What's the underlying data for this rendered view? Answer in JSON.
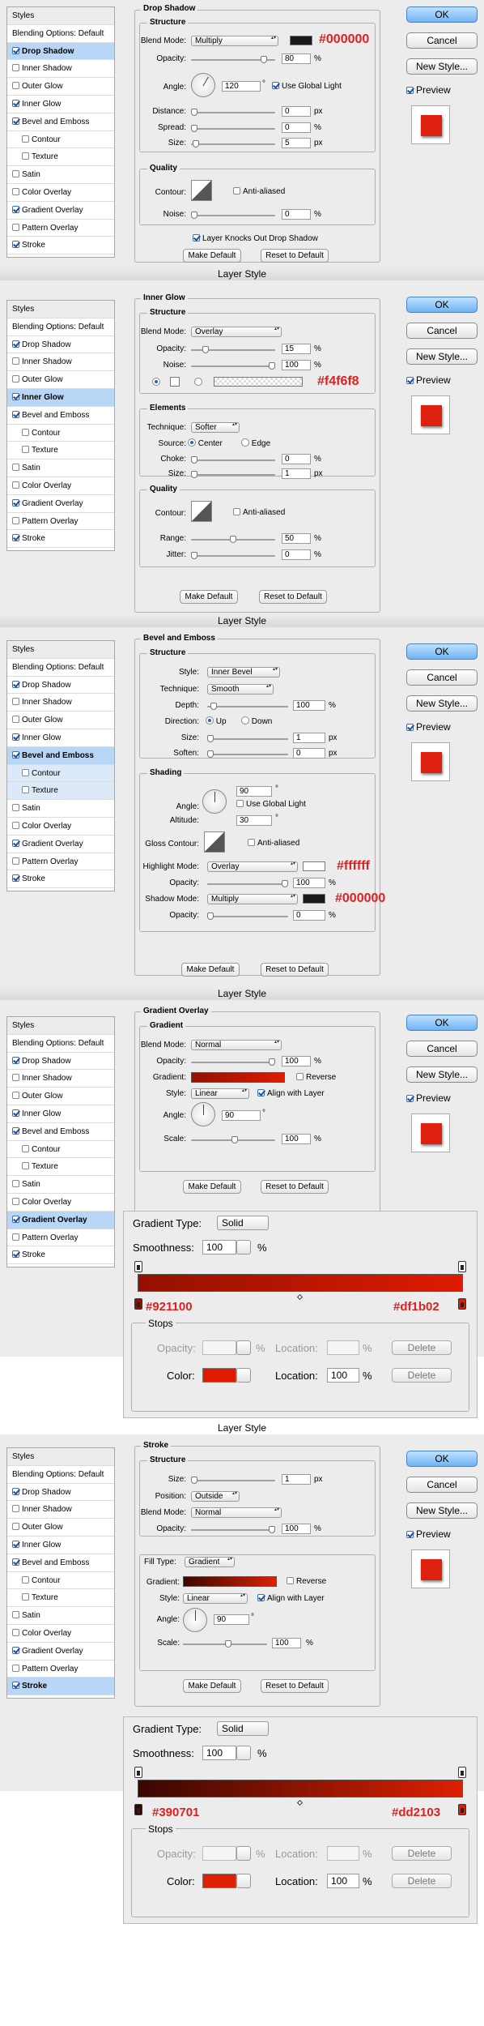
{
  "window_title": "Layer Style",
  "styles_list": [
    "Styles",
    "Blending Options: Default",
    "Drop Shadow",
    "Inner Shadow",
    "Outer Glow",
    "Inner Glow",
    "Bevel and Emboss",
    "Contour",
    "Texture",
    "Satin",
    "Color Overlay",
    "Gradient Overlay",
    "Pattern Overlay",
    "Stroke"
  ],
  "buttons": {
    "ok": "OK",
    "cancel": "Cancel",
    "new_style": "New Style...",
    "preview": "Preview",
    "make_default": "Make Default",
    "reset_default": "Reset to Default"
  },
  "units": {
    "pct": "%",
    "px": "px",
    "deg": "°"
  },
  "drop_shadow": {
    "title": "Drop Shadow",
    "structure": "Structure",
    "blend_mode_label": "Blend Mode:",
    "blend_mode": "Multiply",
    "hex": "#000000",
    "swatch": "#1a1a1a",
    "opacity_label": "Opacity:",
    "opacity": "80",
    "angle_label": "Angle:",
    "angle": "120",
    "global_light": "Use Global Light",
    "distance_label": "Distance:",
    "distance": "0",
    "spread_label": "Spread:",
    "spread": "0",
    "size_label": "Size:",
    "size": "5",
    "quality": "Quality",
    "contour_label": "Contour:",
    "anti_aliased": "Anti-aliased",
    "noise_label": "Noise:",
    "noise": "0",
    "knockout": "Layer Knocks Out Drop Shadow"
  },
  "inner_glow": {
    "title": "Inner Glow",
    "structure": "Structure",
    "blend_mode_label": "Blend Mode:",
    "blend_mode": "Overlay",
    "opacity_label": "Opacity:",
    "opacity": "15",
    "noise_label": "Noise:",
    "noise": "100",
    "hex": "#f4f6f8",
    "elements": "Elements",
    "technique_label": "Technique:",
    "technique": "Softer",
    "source_label": "Source:",
    "center": "Center",
    "edge": "Edge",
    "choke_label": "Choke:",
    "choke": "0",
    "size_label": "Size:",
    "size": "1",
    "quality": "Quality",
    "contour_label": "Contour:",
    "anti_aliased": "Anti-aliased",
    "range_label": "Range:",
    "range": "50",
    "jitter_label": "Jitter:",
    "jitter": "0"
  },
  "bevel": {
    "title": "Bevel and Emboss",
    "structure": "Structure",
    "style_label": "Style:",
    "style": "Inner Bevel",
    "technique_label": "Technique:",
    "technique": "Smooth",
    "depth_label": "Depth:",
    "depth": "100",
    "direction_label": "Direction:",
    "up": "Up",
    "down": "Down",
    "size_label": "Size:",
    "size": "1",
    "soften_label": "Soften:",
    "soften": "0",
    "shading": "Shading",
    "angle_label": "Angle:",
    "angle": "90",
    "global_light": "Use Global Light",
    "altitude_label": "Altitude:",
    "altitude": "30",
    "gloss_label": "Gloss Contour:",
    "anti_aliased": "Anti-aliased",
    "highlight_label": "Highlight Mode:",
    "highlight_mode": "Overlay",
    "highlight_hex": "#ffffff",
    "highlight_swatch": "#ffffff",
    "hl_opacity_label": "Opacity:",
    "hl_opacity": "100",
    "shadow_label": "Shadow Mode:",
    "shadow_mode": "Multiply",
    "shadow_hex": "#000000",
    "shadow_swatch": "#1a1a1a",
    "sh_opacity_label": "Opacity:",
    "sh_opacity": "0"
  },
  "gradient_overlay": {
    "title": "Gradient Overlay",
    "sub": "Gradient",
    "blend_mode_label": "Blend Mode:",
    "blend_mode": "Normal",
    "opacity_label": "Opacity:",
    "opacity": "100",
    "gradient_label": "Gradient:",
    "reverse": "Reverse",
    "style_label": "Style:",
    "style": "Linear",
    "align": "Align with Layer",
    "angle_label": "Angle:",
    "angle": "90",
    "scale_label": "Scale:",
    "scale": "100",
    "start_color": "#921100",
    "end_color": "#df1b02"
  },
  "gradient_editor": {
    "type_label": "Gradient Type:",
    "type": "Solid",
    "smooth_label": "Smoothness:",
    "smoothness": "100",
    "stops": "Stops",
    "opacity_label": "Opacity:",
    "location_label": "Location:",
    "delete": "Delete",
    "color_label": "Color:",
    "location": "100"
  },
  "stroke": {
    "title": "Stroke",
    "structure": "Structure",
    "size_label": "Size:",
    "size": "1",
    "position_label": "Position:",
    "position": "Outside",
    "blend_mode_label": "Blend Mode:",
    "blend_mode": "Normal",
    "opacity_label": "Opacity:",
    "opacity": "100",
    "fill_label": "Fill Type:",
    "fill": "Gradient",
    "gradient_label": "Gradient:",
    "reverse": "Reverse",
    "style_label": "Style:",
    "style": "Linear",
    "align": "Align with Layer",
    "angle_label": "Angle:",
    "angle": "90",
    "scale_label": "Scale:",
    "scale": "100",
    "start_color": "#390701",
    "end_color": "#dd2103"
  }
}
